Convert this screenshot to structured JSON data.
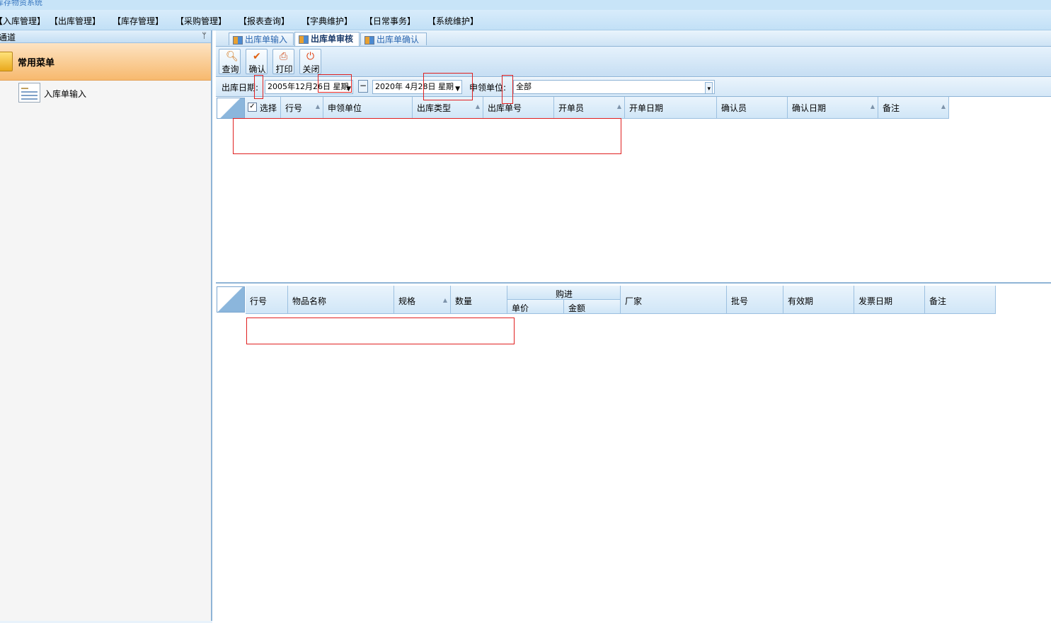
{
  "app": {
    "title": "库存物资系统"
  },
  "menu": [
    "【入库管理】",
    "【出库管理】",
    "【库存管理】",
    "【采购管理】",
    "【报表查询】",
    "【字典维护】",
    "【日常事务】",
    "【系统维护】"
  ],
  "left_panel": {
    "header": "通道",
    "pin": "ᛘ",
    "section_title": "常用菜单",
    "items": [
      "入库单输入"
    ]
  },
  "tabs": [
    "出库单输入",
    "出库单审核",
    "出库单确认"
  ],
  "active_tab": "出库单审核",
  "toolbar": {
    "query": "查询",
    "confirm": "确认",
    "print": "打印",
    "close": "关闭"
  },
  "filters": {
    "date_label": "出库日期:",
    "date_from": "2005年12月26日 星期",
    "minus": "−",
    "date_to": "2020年 4月28日 星期",
    "unit_label": "申领单位:",
    "unit_value": "全部"
  },
  "grid_top": {
    "columns": [
      "选择",
      "行号",
      "申领单位",
      "出库类型",
      "出库单号",
      "开单员",
      "开单日期",
      "确认员",
      "确认日期",
      "备注"
    ]
  },
  "grid_bottom": {
    "columns": [
      "行号",
      "物品名称",
      "规格",
      "数量",
      "厂家",
      "批号",
      "有效期",
      "发票日期",
      "备注"
    ],
    "group": "购进",
    "sub_columns": [
      "单价",
      "金额"
    ]
  }
}
